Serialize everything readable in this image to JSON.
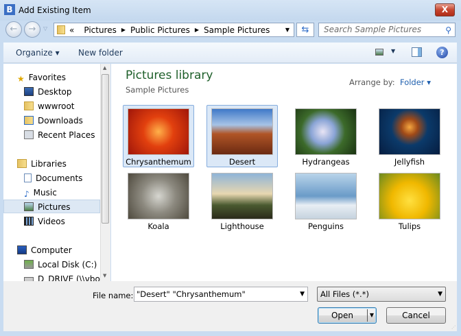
{
  "window": {
    "title": "Add Existing Item",
    "app_icon": "B",
    "close_label": "X"
  },
  "address": {
    "overflow": "«",
    "crumbs": [
      "Pictures",
      "Public Pictures",
      "Sample Pictures"
    ],
    "search_placeholder": "Search Sample Pictures"
  },
  "toolbar": {
    "organize": "Organize ▾",
    "new_folder": "New folder"
  },
  "nav": {
    "items": [
      {
        "label": "Favorites",
        "icon": "star-icon"
      },
      {
        "label": "Desktop",
        "icon": "desktop-icon"
      },
      {
        "label": "wwwroot",
        "icon": "folder-icon"
      },
      {
        "label": "Downloads",
        "icon": "downloads-icon"
      },
      {
        "label": "Recent Places",
        "icon": "recent-places-icon"
      },
      {
        "label": "Libraries",
        "icon": "libraries-icon"
      },
      {
        "label": "Documents",
        "icon": "documents-icon"
      },
      {
        "label": "Music",
        "icon": "music-icon"
      },
      {
        "label": "Pictures",
        "icon": "pictures-icon",
        "selected": true
      },
      {
        "label": "Videos",
        "icon": "videos-icon"
      },
      {
        "label": "Computer",
        "icon": "computer-icon"
      },
      {
        "label": "Local Disk (C:)",
        "icon": "drive-icon"
      },
      {
        "label": "D_DRIVE (\\\\vboxs",
        "icon": "network-drive-icon"
      }
    ]
  },
  "library": {
    "title": "Pictures library",
    "subtitle": "Sample Pictures",
    "arrange_label": "Arrange by:",
    "arrange_value": "Folder ▾"
  },
  "files": [
    {
      "name": "Chrysanthemum",
      "selected": true
    },
    {
      "name": "Desert",
      "selected": true
    },
    {
      "name": "Hydrangeas"
    },
    {
      "name": "Jellyfish"
    },
    {
      "name": "Koala"
    },
    {
      "name": "Lighthouse"
    },
    {
      "name": "Penguins"
    },
    {
      "name": "Tulips"
    }
  ],
  "footer": {
    "file_name_label": "File name:",
    "file_name_value": "\"Desert\" \"Chrysanthemum\"",
    "filter": "All Files (*.*)",
    "open": "Open",
    "cancel": "Cancel"
  }
}
